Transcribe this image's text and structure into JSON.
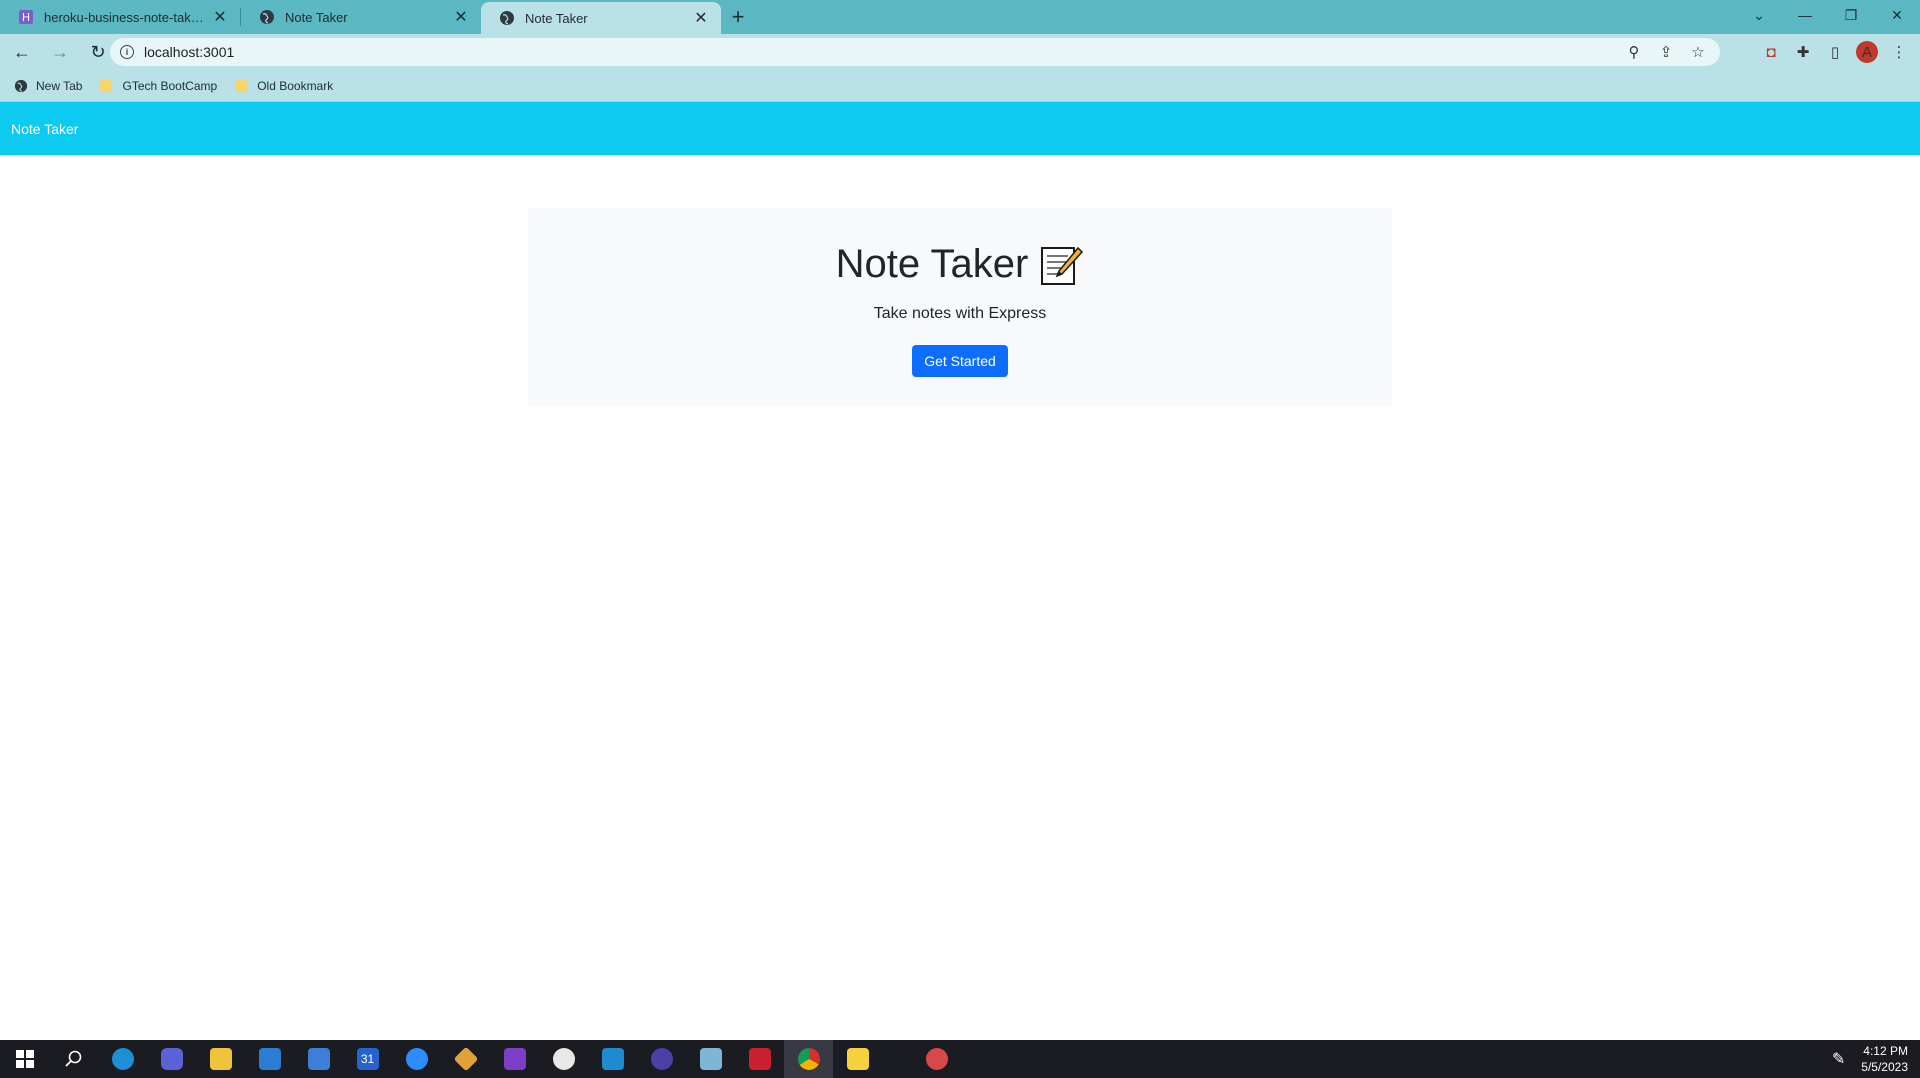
{
  "browser": {
    "tabs": [
      {
        "title": "heroku-business-note-taker · Git",
        "active": false
      },
      {
        "title": "Note Taker",
        "active": false
      },
      {
        "title": "Note Taker",
        "active": true
      }
    ],
    "url": "localhost:3001",
    "profile_initial": "A",
    "bookmarks": [
      {
        "label": "New Tab",
        "type": "page"
      },
      {
        "label": "GTech BootCamp",
        "type": "folder"
      },
      {
        "label": "Old Bookmark",
        "type": "folder"
      }
    ]
  },
  "app": {
    "brand": "Note Taker",
    "hero": {
      "title": "Note Taker",
      "subtitle": "Take notes with Express",
      "cta_label": "Get Started"
    },
    "colors": {
      "navbar": "#0dcaf0",
      "jumbotron": "#f8f9fa",
      "button": "#0d6efd"
    }
  },
  "taskbar": {
    "time": "4:12 PM",
    "date": "5/5/2023",
    "calendar_day": "31"
  }
}
